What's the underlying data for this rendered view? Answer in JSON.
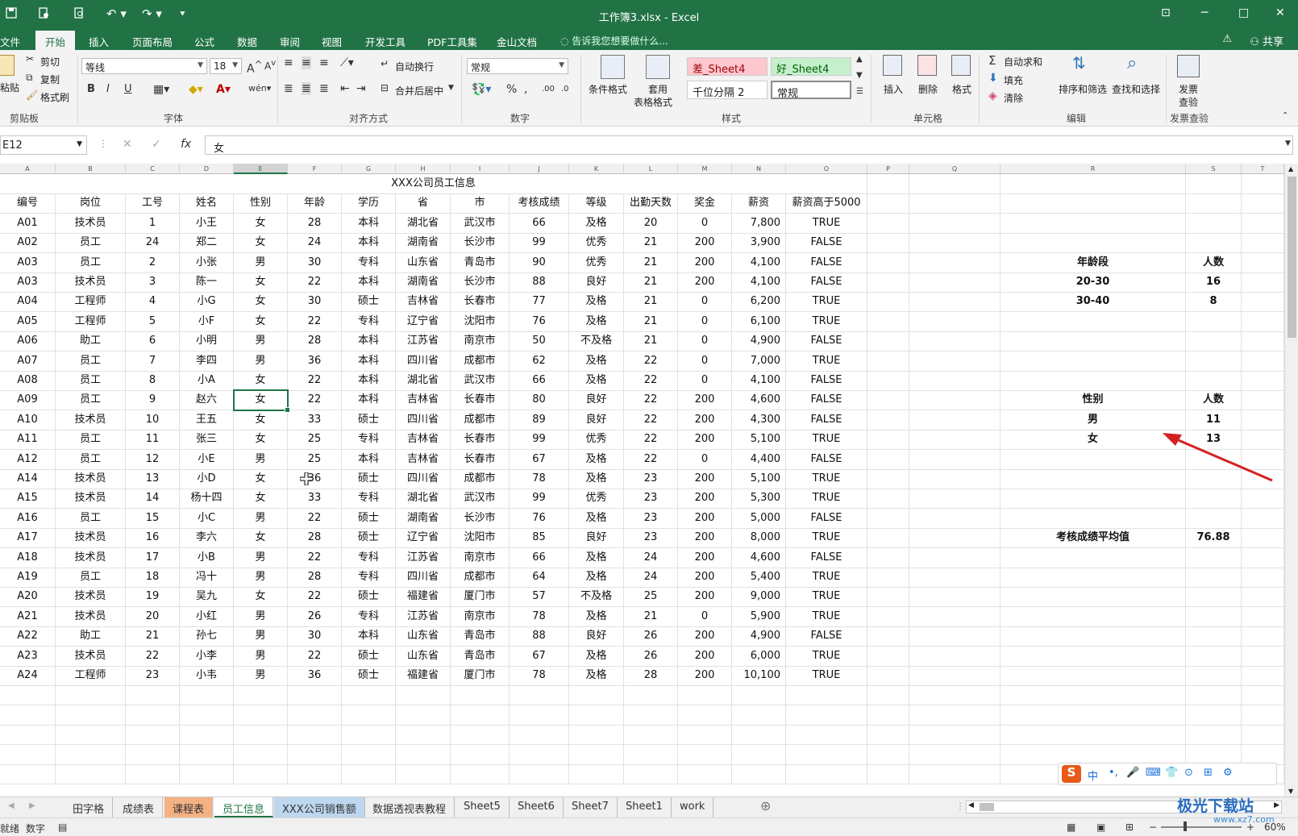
{
  "window": {
    "title": "工作簿3.xlsx - Excel"
  },
  "quick_access": {
    "icons": [
      "save-icon",
      "touch-mode-icon",
      "print-preview-icon",
      "undo-icon",
      "redo-icon",
      "customize-icon"
    ]
  },
  "menu": {
    "items": [
      "文件",
      "开始",
      "插入",
      "页面布局",
      "公式",
      "数据",
      "审阅",
      "视图",
      "开发工具",
      "PDF工具集",
      "金山文档"
    ],
    "active": "开始",
    "tell_me": "告诉我您想要做什么...",
    "share": "共享"
  },
  "ribbon": {
    "clipboard": {
      "paste": "粘贴",
      "cut": "剪切",
      "copy": "复制",
      "format_painter": "格式刷",
      "label": "剪贴板"
    },
    "font": {
      "name": "等线",
      "size": "18",
      "label": "字体",
      "bold": "B",
      "italic": "I",
      "underline": "U"
    },
    "alignment": {
      "wrap": "自动换行",
      "merge": "合并后居中",
      "label": "对齐方式"
    },
    "number": {
      "format": "常规",
      "label": "数字",
      "percent": "%"
    },
    "styles": {
      "conditional": "条件格式",
      "table_format_1": "套用",
      "table_format_2": "表格格式",
      "bad": "差_Sheet4",
      "good": "好_Sheet4",
      "comma": "千位分隔 2",
      "normal": "常规",
      "label": "样式"
    },
    "cells": {
      "insert": "插入",
      "delete": "删除",
      "format": "格式",
      "label": "单元格"
    },
    "editing": {
      "autosum": "自动求和",
      "fill": "填充",
      "clear": "清除",
      "sort": "排序和筛选",
      "find": "查找和选择",
      "label": "编辑"
    },
    "invoice": {
      "check_1": "发票",
      "check_2": "查验",
      "label": "发票查验"
    }
  },
  "formula_bar": {
    "name_box": "E12",
    "content": "女"
  },
  "sheet": {
    "columns": [
      "A",
      "B",
      "C",
      "D",
      "E",
      "F",
      "G",
      "H",
      "I",
      "J",
      "K",
      "L",
      "M",
      "N",
      "O",
      "P",
      "Q",
      "R",
      "S",
      "T"
    ],
    "selected_column": "E",
    "title": "XXX公司员工信息",
    "headers": [
      "编号",
      "岗位",
      "工号",
      "姓名",
      "性别",
      "年龄",
      "学历",
      "省",
      "市",
      "考核成绩",
      "等级",
      "出勤天数",
      "奖金",
      "薪资",
      "薪资高于5000"
    ],
    "rows": [
      [
        "A01",
        "技术员",
        "1",
        "小王",
        "女",
        "28",
        "本科",
        "湖北省",
        "武汉市",
        "66",
        "及格",
        "20",
        "0",
        "7,800",
        "TRUE"
      ],
      [
        "A02",
        "员工",
        "24",
        "郑二",
        "女",
        "24",
        "本科",
        "湖南省",
        "长沙市",
        "99",
        "优秀",
        "21",
        "200",
        "3,900",
        "FALSE"
      ],
      [
        "A03",
        "员工",
        "2",
        "小张",
        "男",
        "30",
        "专科",
        "山东省",
        "青岛市",
        "90",
        "优秀",
        "21",
        "200",
        "4,100",
        "FALSE"
      ],
      [
        "A03",
        "技术员",
        "3",
        "陈一",
        "女",
        "22",
        "本科",
        "湖南省",
        "长沙市",
        "88",
        "良好",
        "21",
        "200",
        "4,100",
        "FALSE"
      ],
      [
        "A04",
        "工程师",
        "4",
        "小G",
        "女",
        "30",
        "硕士",
        "吉林省",
        "长春市",
        "77",
        "及格",
        "21",
        "0",
        "6,200",
        "TRUE"
      ],
      [
        "A05",
        "工程师",
        "5",
        "小F",
        "女",
        "22",
        "专科",
        "辽宁省",
        "沈阳市",
        "76",
        "及格",
        "21",
        "0",
        "6,100",
        "TRUE"
      ],
      [
        "A06",
        "助工",
        "6",
        "小明",
        "男",
        "28",
        "本科",
        "江苏省",
        "南京市",
        "50",
        "不及格",
        "21",
        "0",
        "4,900",
        "FALSE"
      ],
      [
        "A07",
        "员工",
        "7",
        "李四",
        "男",
        "36",
        "本科",
        "四川省",
        "成都市",
        "62",
        "及格",
        "22",
        "0",
        "7,000",
        "TRUE"
      ],
      [
        "A08",
        "员工",
        "8",
        "小A",
        "女",
        "22",
        "本科",
        "湖北省",
        "武汉市",
        "66",
        "及格",
        "22",
        "0",
        "4,100",
        "FALSE"
      ],
      [
        "A09",
        "员工",
        "9",
        "赵六",
        "女",
        "22",
        "本科",
        "吉林省",
        "长春市",
        "80",
        "良好",
        "22",
        "200",
        "4,600",
        "FALSE"
      ],
      [
        "A10",
        "技术员",
        "10",
        "王五",
        "女",
        "33",
        "硕士",
        "四川省",
        "成都市",
        "89",
        "良好",
        "22",
        "200",
        "4,300",
        "FALSE"
      ],
      [
        "A11",
        "员工",
        "11",
        "张三",
        "女",
        "25",
        "专科",
        "吉林省",
        "长春市",
        "99",
        "优秀",
        "22",
        "200",
        "5,100",
        "TRUE"
      ],
      [
        "A12",
        "员工",
        "12",
        "小E",
        "男",
        "25",
        "本科",
        "吉林省",
        "长春市",
        "67",
        "及格",
        "22",
        "0",
        "4,400",
        "FALSE"
      ],
      [
        "A14",
        "技术员",
        "13",
        "小D",
        "女",
        "36",
        "硕士",
        "四川省",
        "成都市",
        "78",
        "及格",
        "23",
        "200",
        "5,100",
        "TRUE"
      ],
      [
        "A15",
        "技术员",
        "14",
        "杨十四",
        "女",
        "33",
        "专科",
        "湖北省",
        "武汉市",
        "99",
        "优秀",
        "23",
        "200",
        "5,300",
        "TRUE"
      ],
      [
        "A16",
        "员工",
        "15",
        "小C",
        "男",
        "22",
        "硕士",
        "湖南省",
        "长沙市",
        "76",
        "及格",
        "23",
        "200",
        "5,000",
        "FALSE"
      ],
      [
        "A17",
        "技术员",
        "16",
        "李六",
        "女",
        "28",
        "硕士",
        "辽宁省",
        "沈阳市",
        "85",
        "良好",
        "23",
        "200",
        "8,000",
        "TRUE"
      ],
      [
        "A18",
        "技术员",
        "17",
        "小B",
        "男",
        "22",
        "专科",
        "江苏省",
        "南京市",
        "66",
        "及格",
        "24",
        "200",
        "4,600",
        "FALSE"
      ],
      [
        "A19",
        "员工",
        "18",
        "冯十",
        "男",
        "28",
        "专科",
        "四川省",
        "成都市",
        "64",
        "及格",
        "24",
        "200",
        "5,400",
        "TRUE"
      ],
      [
        "A20",
        "技术员",
        "19",
        "吴九",
        "女",
        "22",
        "硕士",
        "福建省",
        "厦门市",
        "57",
        "不及格",
        "25",
        "200",
        "9,000",
        "TRUE"
      ],
      [
        "A21",
        "技术员",
        "20",
        "小红",
        "男",
        "26",
        "专科",
        "江苏省",
        "南京市",
        "78",
        "及格",
        "21",
        "0",
        "5,900",
        "TRUE"
      ],
      [
        "A22",
        "助工",
        "21",
        "孙七",
        "男",
        "30",
        "本科",
        "山东省",
        "青岛市",
        "88",
        "良好",
        "26",
        "200",
        "4,900",
        "FALSE"
      ],
      [
        "A23",
        "技术员",
        "22",
        "小李",
        "男",
        "22",
        "硕士",
        "山东省",
        "青岛市",
        "67",
        "及格",
        "26",
        "200",
        "6,000",
        "TRUE"
      ],
      [
        "A24",
        "工程师",
        "23",
        "小韦",
        "男",
        "36",
        "硕士",
        "福建省",
        "厦门市",
        "78",
        "及格",
        "28",
        "200",
        "10,100",
        "TRUE"
      ]
    ],
    "summary": {
      "age_header": "年龄段",
      "count_header": "人数",
      "age_rows": [
        [
          "20-30",
          "16"
        ],
        [
          "30-40",
          "8"
        ]
      ],
      "gender_header": "性别",
      "gender_count_header": "人数",
      "gender_rows": [
        [
          "男",
          "11"
        ],
        [
          "女",
          "13"
        ]
      ],
      "avg_label": "考核成绩平均值",
      "avg_value": "76.88"
    }
  },
  "tabs": {
    "items": [
      "田字格",
      "成绩表",
      "课程表",
      "员工信息",
      "XXX公司销售额",
      "数据透视表教程",
      "Sheet5",
      "Sheet6",
      "Sheet7",
      "Sheet1",
      "work"
    ],
    "active": "员工信息",
    "colors": {
      "课程表": "#f4b183",
      "XXX公司销售额": "#bdd7ee"
    }
  },
  "status": {
    "ready": "就绪",
    "mode": "数字",
    "zoom": "60%"
  },
  "ime": {
    "text": "中"
  },
  "watermark": {
    "brand": "极光下载站",
    "url": "www.xz7.com"
  },
  "colors": {
    "accent": "#217346",
    "arrow": "#d42020",
    "bad_style_bg": "#ffc7ce",
    "good_style_bg": "#c6efce"
  }
}
